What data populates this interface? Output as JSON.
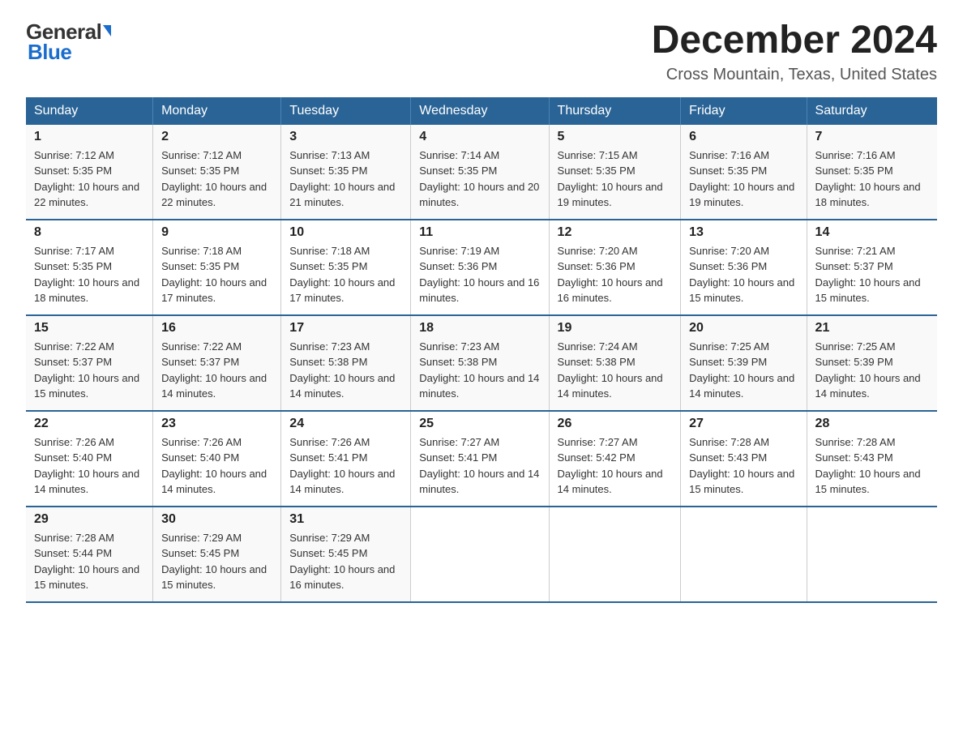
{
  "header": {
    "logo_general": "General",
    "logo_blue": "Blue",
    "month_title": "December 2024",
    "location": "Cross Mountain, Texas, United States"
  },
  "days_of_week": [
    "Sunday",
    "Monday",
    "Tuesday",
    "Wednesday",
    "Thursday",
    "Friday",
    "Saturday"
  ],
  "weeks": [
    [
      {
        "day": "1",
        "sunrise": "7:12 AM",
        "sunset": "5:35 PM",
        "daylight": "10 hours and 22 minutes."
      },
      {
        "day": "2",
        "sunrise": "7:12 AM",
        "sunset": "5:35 PM",
        "daylight": "10 hours and 22 minutes."
      },
      {
        "day": "3",
        "sunrise": "7:13 AM",
        "sunset": "5:35 PM",
        "daylight": "10 hours and 21 minutes."
      },
      {
        "day": "4",
        "sunrise": "7:14 AM",
        "sunset": "5:35 PM",
        "daylight": "10 hours and 20 minutes."
      },
      {
        "day": "5",
        "sunrise": "7:15 AM",
        "sunset": "5:35 PM",
        "daylight": "10 hours and 19 minutes."
      },
      {
        "day": "6",
        "sunrise": "7:16 AM",
        "sunset": "5:35 PM",
        "daylight": "10 hours and 19 minutes."
      },
      {
        "day": "7",
        "sunrise": "7:16 AM",
        "sunset": "5:35 PM",
        "daylight": "10 hours and 18 minutes."
      }
    ],
    [
      {
        "day": "8",
        "sunrise": "7:17 AM",
        "sunset": "5:35 PM",
        "daylight": "10 hours and 18 minutes."
      },
      {
        "day": "9",
        "sunrise": "7:18 AM",
        "sunset": "5:35 PM",
        "daylight": "10 hours and 17 minutes."
      },
      {
        "day": "10",
        "sunrise": "7:18 AM",
        "sunset": "5:35 PM",
        "daylight": "10 hours and 17 minutes."
      },
      {
        "day": "11",
        "sunrise": "7:19 AM",
        "sunset": "5:36 PM",
        "daylight": "10 hours and 16 minutes."
      },
      {
        "day": "12",
        "sunrise": "7:20 AM",
        "sunset": "5:36 PM",
        "daylight": "10 hours and 16 minutes."
      },
      {
        "day": "13",
        "sunrise": "7:20 AM",
        "sunset": "5:36 PM",
        "daylight": "10 hours and 15 minutes."
      },
      {
        "day": "14",
        "sunrise": "7:21 AM",
        "sunset": "5:37 PM",
        "daylight": "10 hours and 15 minutes."
      }
    ],
    [
      {
        "day": "15",
        "sunrise": "7:22 AM",
        "sunset": "5:37 PM",
        "daylight": "10 hours and 15 minutes."
      },
      {
        "day": "16",
        "sunrise": "7:22 AM",
        "sunset": "5:37 PM",
        "daylight": "10 hours and 14 minutes."
      },
      {
        "day": "17",
        "sunrise": "7:23 AM",
        "sunset": "5:38 PM",
        "daylight": "10 hours and 14 minutes."
      },
      {
        "day": "18",
        "sunrise": "7:23 AM",
        "sunset": "5:38 PM",
        "daylight": "10 hours and 14 minutes."
      },
      {
        "day": "19",
        "sunrise": "7:24 AM",
        "sunset": "5:38 PM",
        "daylight": "10 hours and 14 minutes."
      },
      {
        "day": "20",
        "sunrise": "7:25 AM",
        "sunset": "5:39 PM",
        "daylight": "10 hours and 14 minutes."
      },
      {
        "day": "21",
        "sunrise": "7:25 AM",
        "sunset": "5:39 PM",
        "daylight": "10 hours and 14 minutes."
      }
    ],
    [
      {
        "day": "22",
        "sunrise": "7:26 AM",
        "sunset": "5:40 PM",
        "daylight": "10 hours and 14 minutes."
      },
      {
        "day": "23",
        "sunrise": "7:26 AM",
        "sunset": "5:40 PM",
        "daylight": "10 hours and 14 minutes."
      },
      {
        "day": "24",
        "sunrise": "7:26 AM",
        "sunset": "5:41 PM",
        "daylight": "10 hours and 14 minutes."
      },
      {
        "day": "25",
        "sunrise": "7:27 AM",
        "sunset": "5:41 PM",
        "daylight": "10 hours and 14 minutes."
      },
      {
        "day": "26",
        "sunrise": "7:27 AM",
        "sunset": "5:42 PM",
        "daylight": "10 hours and 14 minutes."
      },
      {
        "day": "27",
        "sunrise": "7:28 AM",
        "sunset": "5:43 PM",
        "daylight": "10 hours and 15 minutes."
      },
      {
        "day": "28",
        "sunrise": "7:28 AM",
        "sunset": "5:43 PM",
        "daylight": "10 hours and 15 minutes."
      }
    ],
    [
      {
        "day": "29",
        "sunrise": "7:28 AM",
        "sunset": "5:44 PM",
        "daylight": "10 hours and 15 minutes."
      },
      {
        "day": "30",
        "sunrise": "7:29 AM",
        "sunset": "5:45 PM",
        "daylight": "10 hours and 15 minutes."
      },
      {
        "day": "31",
        "sunrise": "7:29 AM",
        "sunset": "5:45 PM",
        "daylight": "10 hours and 16 minutes."
      },
      null,
      null,
      null,
      null
    ]
  ],
  "labels": {
    "sunrise": "Sunrise:",
    "sunset": "Sunset:",
    "daylight": "Daylight:"
  }
}
